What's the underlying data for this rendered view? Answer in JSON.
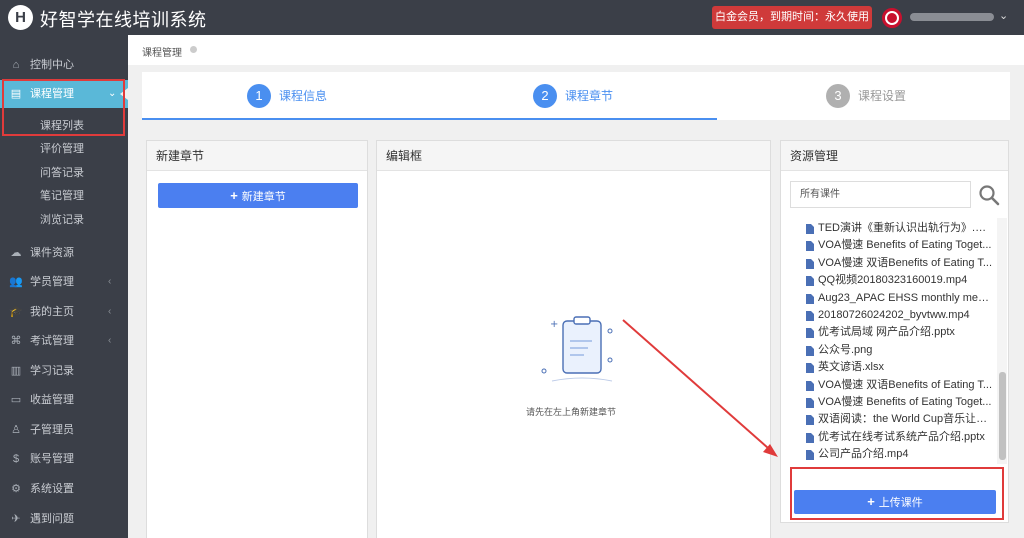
{
  "header": {
    "logo_letter": "H",
    "app_title": "好智学在线培训系统",
    "member_badge": "白金会员，到期时间：永久使用",
    "user_caret": "⌄"
  },
  "sidebar": {
    "items": [
      {
        "label": "控制中心",
        "icon": "home-icon",
        "glyph": "⌂"
      },
      {
        "label": "课程管理",
        "icon": "book-icon",
        "glyph": "▤",
        "active": true,
        "arrow": "⌄"
      },
      {
        "label": "课件资源",
        "icon": "cloud-icon",
        "glyph": "☁"
      },
      {
        "label": "学员管理",
        "icon": "users-icon",
        "glyph": "👥",
        "arrow": "‹"
      },
      {
        "label": "我的主页",
        "icon": "graduation-cap-icon",
        "glyph": "🎓",
        "arrow": "‹"
      },
      {
        "label": "考试管理",
        "icon": "tag-icon",
        "glyph": "⌘",
        "arrow": "‹"
      },
      {
        "label": "学习记录",
        "icon": "book-open-icon",
        "glyph": "▥"
      },
      {
        "label": "收益管理",
        "icon": "card-icon",
        "glyph": "▭"
      },
      {
        "label": "子管理员",
        "icon": "user-lock-icon",
        "glyph": "♙"
      },
      {
        "label": "账号管理",
        "icon": "dollar-icon",
        "glyph": "$"
      },
      {
        "label": "系统设置",
        "icon": "gear-icon",
        "glyph": "⚙"
      },
      {
        "label": "遇到问题",
        "icon": "question-icon",
        "glyph": "✈"
      }
    ],
    "sub_items": [
      "课程列表",
      "评价管理",
      "问答记录",
      "笔记管理",
      "浏览记录"
    ]
  },
  "breadcrumb": {
    "label": "课程管理"
  },
  "steps": [
    {
      "num": "1",
      "label": "课程信息",
      "active": true
    },
    {
      "num": "2",
      "label": "课程章节",
      "active": true
    },
    {
      "num": "3",
      "label": "课程设置",
      "active": false
    }
  ],
  "panels": {
    "new_chapter": {
      "title": "新建章节",
      "button_label": "新建章节"
    },
    "editor": {
      "title": "编辑框",
      "empty_text": "请先在左上角新建章节"
    },
    "resources": {
      "title": "资源管理",
      "search_value": "所有课件",
      "upload_label": "上传课件",
      "files": [
        "TED演讲《重新认识出轨行为》.mp4",
        "VOA慢速 Benefits of Eating Toget...",
        "VOA慢速 双语Benefits of Eating T...",
        "QQ视频20180323160019.mp4",
        "Aug23_APAC EHSS monthly meet...",
        "20180726024202_byvtww.mp4",
        "优考试局域 网产品介绍.pptx",
        "公众号.png",
        "英文谚语.xlsx",
        "VOA慢速 双语Benefits of Eating T...",
        "VOA慢速 Benefits of Eating Toget...",
        "双语阅读：the World Cup音乐让世...",
        "优考试在线考试系统产品介绍.pptx",
        "公司产品介绍.mp4"
      ]
    }
  },
  "colors": {
    "sidebar_bg": "#3b3f48",
    "active_item": "#5ab8d8",
    "primary": "#4b7ff0",
    "badge": "#cf3a3a",
    "highlight": "#e03b3b"
  }
}
